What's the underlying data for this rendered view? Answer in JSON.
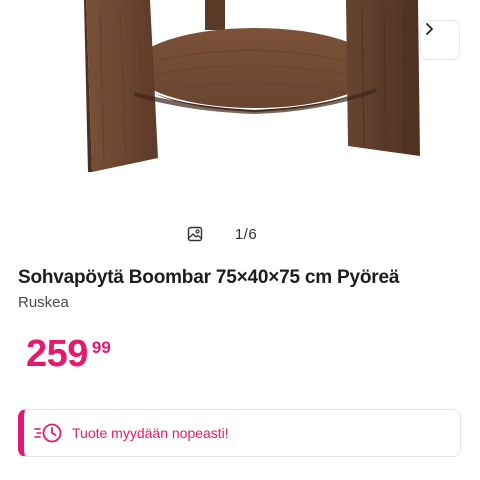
{
  "gallery": {
    "current": 1,
    "total": 6,
    "counter_text": "1/6",
    "image_icon": "image-gallery-icon",
    "next_icon": "chevron-right-icon"
  },
  "product": {
    "title": "Sohvapöytä Boombar 75×40×75 cm Pyöreä",
    "color": "Ruskea",
    "price_integer": "259",
    "price_decimals": "99"
  },
  "badge": {
    "icon": "fast-clock-icon",
    "text": "Tuote myydään nopeasti!"
  },
  "colors": {
    "accent": "#e6196e",
    "wood": "#6b4630"
  }
}
